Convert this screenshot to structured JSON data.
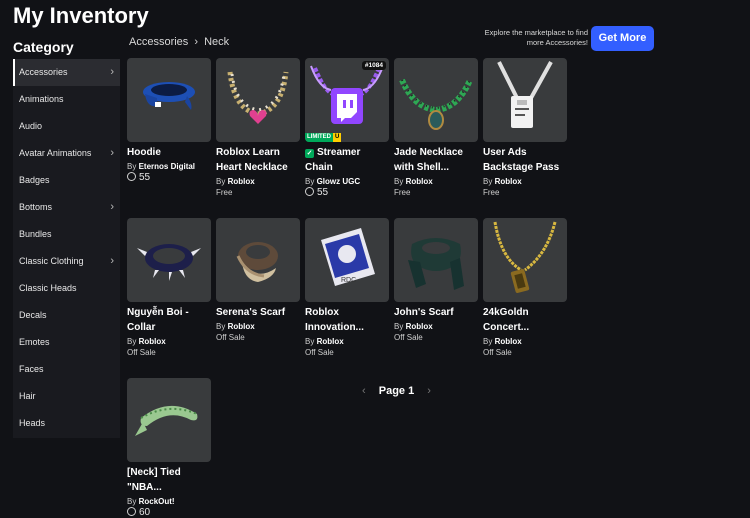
{
  "page_title": "My Inventory",
  "sidebar": {
    "heading": "Category",
    "items": [
      {
        "label": "Accessories",
        "chevron": true,
        "active": true
      },
      {
        "label": "Animations",
        "chevron": false
      },
      {
        "label": "Audio",
        "chevron": false
      },
      {
        "label": "Avatar Animations",
        "chevron": true
      },
      {
        "label": "Badges",
        "chevron": false
      },
      {
        "label": "Bottoms",
        "chevron": true
      },
      {
        "label": "Bundles",
        "chevron": false
      },
      {
        "label": "Classic Clothing",
        "chevron": true
      },
      {
        "label": "Classic Heads",
        "chevron": false
      },
      {
        "label": "Decals",
        "chevron": false
      },
      {
        "label": "Emotes",
        "chevron": false
      },
      {
        "label": "Faces",
        "chevron": false
      },
      {
        "label": "Hair",
        "chevron": false
      },
      {
        "label": "Heads",
        "chevron": false
      }
    ]
  },
  "breadcrumb": {
    "parent": "Accessories",
    "separator": "›",
    "current": "Neck"
  },
  "promo": {
    "text": "Explore the marketplace to find more Accessories!",
    "button": "Get More"
  },
  "items": [
    {
      "name": "Hoodie",
      "by": "By",
      "creator": "Eternos Digital",
      "price": "55",
      "robux": true,
      "icon": "hoodie-blue"
    },
    {
      "name": "Roblox Learn\nHeart Necklace",
      "by": "By",
      "creator": "Roblox",
      "price": "Free",
      "robux": false,
      "icon": "heart-necklace"
    },
    {
      "name": "Streamer\nChain",
      "by": "By",
      "creator": "Glowz UGC",
      "price": "55",
      "robux": true,
      "serial": "#1084",
      "limited": "LIMITED",
      "limited_u": "U",
      "verified": true,
      "icon": "streamer-chain"
    },
    {
      "name": "Jade Necklace\nwith Shell...",
      "by": "By",
      "creator": "Roblox",
      "price": "Free",
      "robux": false,
      "icon": "jade-necklace"
    },
    {
      "name": "User Ads\nBackstage Pass",
      "by": "By",
      "creator": "Roblox",
      "price": "Free",
      "robux": false,
      "icon": "backstage-pass"
    },
    {
      "name": "Nguyễn Boi -\nCollar",
      "by": "By",
      "creator": "Roblox",
      "price": "Off Sale",
      "robux": false,
      "icon": "spike-collar"
    },
    {
      "name": "Serena's Scarf",
      "by": "By",
      "creator": "Roblox",
      "price": "Off Sale",
      "robux": false,
      "icon": "serena-scarf"
    },
    {
      "name": "Roblox\nInnovation...",
      "by": "By",
      "creator": "Roblox",
      "price": "Off Sale",
      "robux": false,
      "icon": "innovation-badge"
    },
    {
      "name": "John's Scarf",
      "by": "By",
      "creator": "Roblox",
      "price": "Off Sale",
      "robux": false,
      "icon": "johns-scarf"
    },
    {
      "name": "24kGoldn\nConcert...",
      "by": "By",
      "creator": "Roblox",
      "price": "Off Sale",
      "robux": false,
      "icon": "gold-chain"
    },
    {
      "name": "[Neck] Tied\n\"NBA...",
      "by": "By",
      "creator": "RockOut!",
      "price": "60",
      "robux": true,
      "icon": "tied-bandana"
    }
  ],
  "pagination": {
    "label": "Page 1",
    "prev": "‹",
    "next": "›"
  },
  "colors": {
    "accent": "#335fff",
    "background": "#111216",
    "card": "#393b3d",
    "limited": "#00a85a",
    "limited_u": "#ffce00"
  }
}
